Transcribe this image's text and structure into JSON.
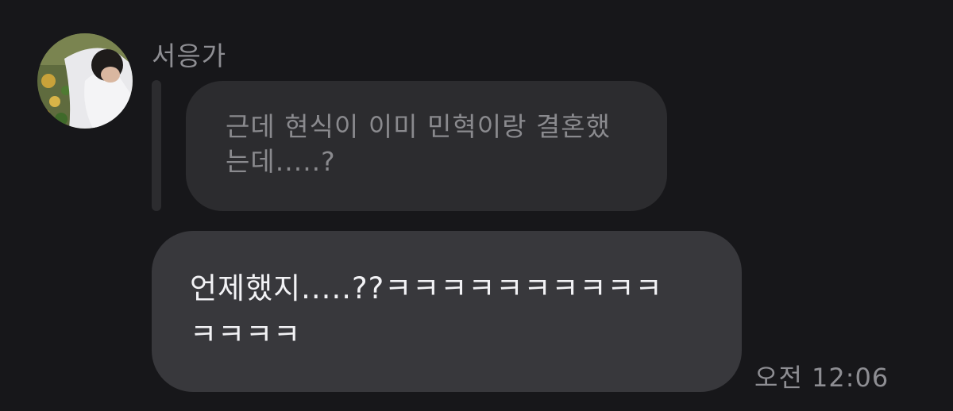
{
  "message_group": {
    "sender_name": "서응가",
    "avatar_icon": "profile-photo-avatar",
    "reply_preview": {
      "text": "근데 현식이 이미 민혁이랑 결혼했\n는데.....?"
    },
    "message": {
      "text": "언제했지.....??ㅋㅋㅋㅋㅋㅋㅋㅋㅋㅋ\nㅋㅋㅋㅋ",
      "timestamp": "오전 12:06"
    }
  },
  "colors": {
    "background": "#17171a",
    "quoted_bubble": "#2c2c2f",
    "message_bubble": "#38383c",
    "secondary_text": "#8e8e93",
    "primary_text": "#f2f2f5"
  }
}
